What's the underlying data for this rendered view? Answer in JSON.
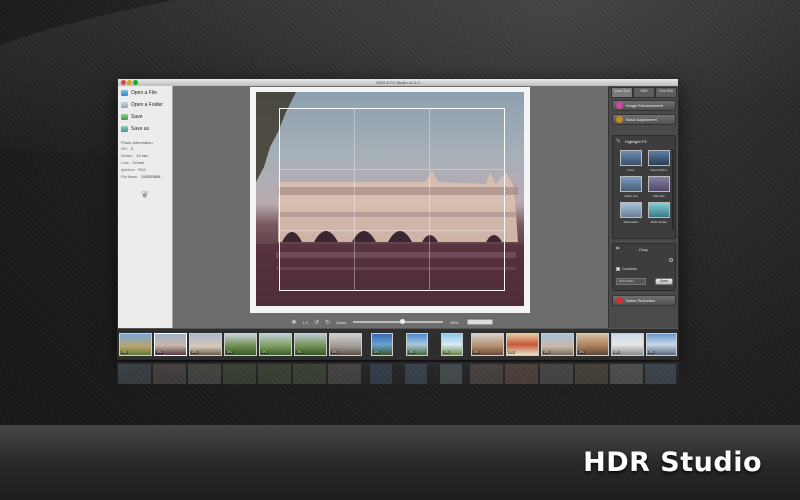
{
  "window": {
    "title": "HDR & FX Studio v1.0.0"
  },
  "left_panel": {
    "items": [
      {
        "label": "Open a File",
        "icon": "image-file-icon"
      },
      {
        "label": "Open a Folder",
        "icon": "folder-icon"
      },
      {
        "label": "Save",
        "icon": "save-icon"
      },
      {
        "label": "Save as",
        "icon": "save-as-icon"
      }
    ],
    "info_title": "Photo Information",
    "info_rows": [
      {
        "key": "ISO:",
        "value": "0"
      },
      {
        "key": "Shutter:",
        "value": "1/1 sec"
      },
      {
        "key": "Lens:",
        "value": "0.0 mm"
      },
      {
        "key": "Aperture:",
        "value": "F0.0"
      },
      {
        "key": "File Name:",
        "value": "1002876584..."
      }
    ]
  },
  "zoom_bar": {
    "ratio_label": "1:1",
    "zoom_label": "Zoom",
    "zoom_value": "84%",
    "zoom_fraction": 0.84
  },
  "right_panel": {
    "tabs": [
      "Quick Edit",
      "HDR",
      "Fine Edit"
    ],
    "buttons": [
      {
        "label": "Image Enhancement",
        "color": "#d04aa0"
      },
      {
        "label": "Basic Adjustment",
        "color": "#c08a2a"
      }
    ],
    "highlight_fx": {
      "title": "Highlight FX",
      "presets": [
        "None",
        "Faux HDR-1",
        "Dawn Lite",
        "Mild-rain",
        "Whitewash",
        "Brite Shade"
      ]
    },
    "crop": {
      "title": "Crop",
      "constrain_label": "Constrain",
      "ratio_value": "3024x4032",
      "done_label": "Done"
    },
    "noise_reduction": {
      "label": "Noise Reduction",
      "color": "#d03030"
    }
  },
  "filmstrip": {
    "tags": [
      "JPG",
      "JPG",
      "JPG",
      "JPG",
      "JPG",
      "JPG",
      "JPG",
      "JPG",
      "JPG",
      "JPG",
      "JPG",
      "JPG",
      "JPG",
      "JPG",
      "JPG",
      "JPG"
    ]
  },
  "brand": {
    "name": "HDR Studio"
  }
}
